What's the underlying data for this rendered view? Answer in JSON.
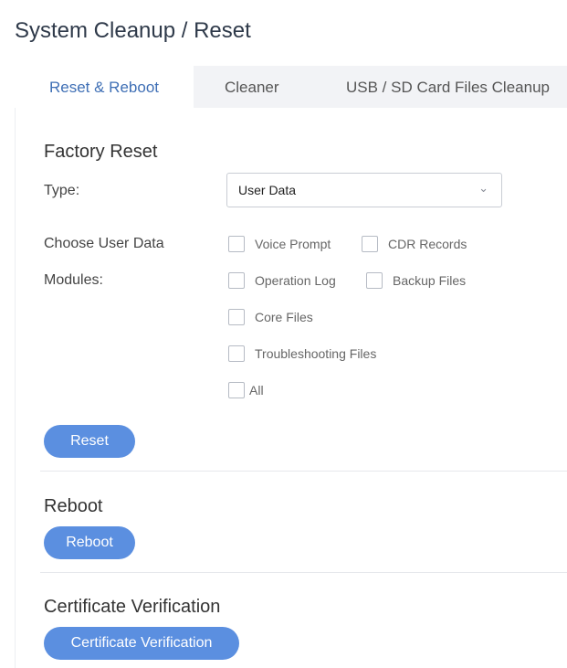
{
  "page": {
    "title": "System Cleanup / Reset"
  },
  "tabs": [
    {
      "label": "Reset & Reboot",
      "active": true
    },
    {
      "label": "Cleaner",
      "active": false
    },
    {
      "label": "USB / SD Card Files Cleanup",
      "active": false
    }
  ],
  "factory_reset": {
    "title": "Factory Reset",
    "type_label": "Type:",
    "type_value": "User Data",
    "modules_label_line1": "Choose User Data",
    "modules_label_line2": "Modules:",
    "options": [
      {
        "label": "Voice Prompt",
        "checked": false
      },
      {
        "label": "CDR Records",
        "checked": false
      },
      {
        "label": "Operation Log",
        "checked": false
      },
      {
        "label": "Backup Files",
        "checked": false
      },
      {
        "label": "Core Files",
        "checked": false
      },
      {
        "label": "Troubleshooting Files",
        "checked": false
      },
      {
        "label": "All",
        "checked": false
      }
    ],
    "reset_button": "Reset"
  },
  "reboot": {
    "title": "Reboot",
    "button": "Reboot"
  },
  "certificate": {
    "title": "Certificate Verification",
    "button": "Certificate Verification"
  },
  "colors": {
    "accent": "#5b8fe0",
    "active_tab_text": "#3f6fb5",
    "tabbar_bg": "#f2f3f6"
  },
  "icons": {
    "select_arrow": "chevron-down-icon"
  }
}
